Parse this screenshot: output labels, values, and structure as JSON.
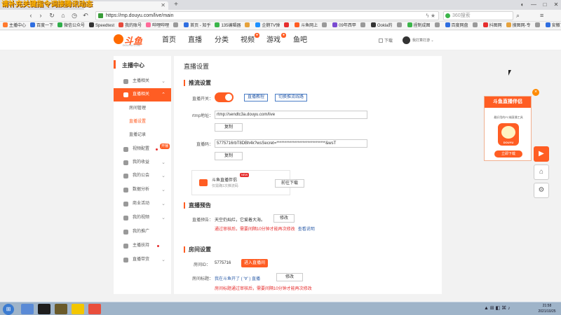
{
  "overlay": {
    "title": "请补充关键指令词接腾讯动态"
  },
  "browser": {
    "url": "https://mp.douyu.com/live/main",
    "search_placeholder": "360搜索",
    "bookmarks": [
      {
        "label": "主播中心",
        "color": "#ff7a2e"
      },
      {
        "label": "百度一下",
        "color": "#2f6ee0"
      },
      {
        "label": "微信公众号",
        "color": "#2fae4a"
      },
      {
        "label": "Speedtest",
        "color": "#333333"
      },
      {
        "label": "我的账号",
        "color": "#e64b3c"
      },
      {
        "label": "哔哩哔哩",
        "color": "#ff6b9a"
      },
      {
        "label": "",
        "color": "#999999"
      },
      {
        "label": "首页 - 知乎",
        "color": "#2f6ee0"
      },
      {
        "label": "135编辑器",
        "color": "#3bb54a"
      },
      {
        "label": "",
        "color": "#e6a23c"
      },
      {
        "label": "企鹅TV弹",
        "color": "#1e90ff"
      },
      {
        "label": "",
        "color": "#e62e2e"
      },
      {
        "label": "斗鱼网上",
        "color": "#ff5d23"
      },
      {
        "label": "",
        "color": "#999999"
      },
      {
        "label": "09年西甲",
        "color": "#7a4bd1"
      },
      {
        "label": "",
        "color": "#999999"
      },
      {
        "label": "Ookla的",
        "color": "#333333"
      },
      {
        "label": "",
        "color": "#999999"
      },
      {
        "label": "捏制成图",
        "color": "#3bb54a"
      },
      {
        "label": "",
        "color": "#999999"
      },
      {
        "label": "百度网盘",
        "color": "#2f6ee0"
      },
      {
        "label": "",
        "color": "#999999"
      },
      {
        "label": "抖图网",
        "color": "#e62e2e"
      },
      {
        "label": "搜图网-专",
        "color": "#e6a23c"
      },
      {
        "label": "",
        "color": "#999999"
      },
      {
        "label": "安徽了",
        "color": "#2f6ee0"
      },
      {
        "label": "音范识别",
        "color": "#ff5d23"
      }
    ]
  },
  "site": {
    "logo_text": "斗鱼",
    "logo_sub": "DOUYU.COM",
    "nav": [
      {
        "label": "首页"
      },
      {
        "label": "直播"
      },
      {
        "label": "分类"
      },
      {
        "label": "视频",
        "badge": ""
      },
      {
        "label": "游戏",
        "badge": ""
      },
      {
        "label": "鱼吧"
      }
    ],
    "download_label": "下载",
    "user_name": "我打算打游"
  },
  "sidebar": {
    "title": "主播中心",
    "items": [
      {
        "label": "主播相关",
        "arrow": "⌄"
      },
      {
        "label": "直播相关",
        "arrow": "⌃",
        "active": true
      },
      {
        "sub": "房间管理"
      },
      {
        "sub": "直播设置",
        "current": true
      },
      {
        "sub": "直播记录"
      },
      {
        "label": "视频配置",
        "arrow": "",
        "tag": "开播"
      },
      {
        "label": "我的收益",
        "arrow": "⌄"
      },
      {
        "label": "我的公会",
        "arrow": "⌄"
      },
      {
        "label": "数据分析",
        "arrow": "⌄"
      },
      {
        "label": "商业活动",
        "arrow": "⌄"
      },
      {
        "label": "我的视频",
        "arrow": "⌄"
      },
      {
        "label": "我的推广",
        "arrow": ""
      },
      {
        "label": "主播扶持",
        "arrow": ""
      },
      {
        "label": "直播带货",
        "arrow": "⌄"
      }
    ]
  },
  "content": {
    "page_title": "直播设置",
    "push": {
      "section": "推流设置",
      "switch_label": "直播开关：",
      "tutorial_btn": "直播教程",
      "switch_line_btn": "切换推流线路",
      "rtmp_label": "rtmp地址：",
      "rtmp_value": "rtmp://sendtc3a.douyu.com/live",
      "copy_btn": "复制",
      "code_label": "直播码：",
      "code_value": "5775716rbT8DBh4k?wsSecret=******************************&wsT",
      "copy_btn2": "复制"
    },
    "companion": {
      "name": "斗鱼直播伴侣",
      "desc": "仅需确1次推流码",
      "new_badge": "NEW",
      "download_btn": "前往下载"
    },
    "preview": {
      "section": "直播预告",
      "label": "直播预告：",
      "value": "天空仍灿烂，它爱着大海。",
      "edit_btn": "修改",
      "notice": "通过审核后，需要间隔10分钟才能再次修改",
      "view_link": "查看说明"
    },
    "room": {
      "section": "房间设置",
      "id_label": "房间ID：",
      "id_value": "5775716",
      "enter_btn": "进入直播间",
      "title_label": "房间标题：",
      "title_value": "我在斗鱼开了 ( '∀' ) 直播",
      "edit_btn": "修改",
      "notice": "房间标题通过审核后，需要间隔10分钟才能再次修改"
    }
  },
  "ad": {
    "title": "斗鱼直播伴侣",
    "desc": "最好用的PC端直播工具",
    "logo_text": "DOUYU",
    "download_btn": "立即下载",
    "close": "×"
  },
  "side_tools": {
    "play": "▶",
    "home": "⌂",
    "share": "⚙"
  },
  "taskbar": {
    "tray_text": "▲ ⊞ ◧ ⌘ ♪",
    "time": "21:58",
    "date": "2021/10/25"
  }
}
